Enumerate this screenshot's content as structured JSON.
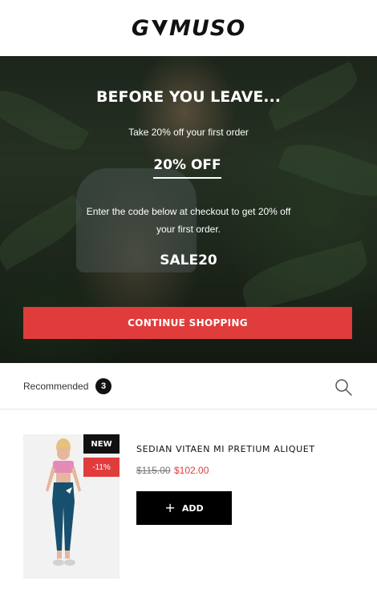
{
  "header": {
    "logo_left": "G",
    "logo_right": "MUSO",
    "logo_icon": "v-mark-icon"
  },
  "hero": {
    "title": "BEFORE YOU LEAVE...",
    "subtitle": "Take 20% off your first order",
    "discount_label": "20% OFF",
    "description": "Enter the code below at checkout to get 20% off your first order.",
    "code": "SALE20",
    "continue_label": "CONTINUE SHOPPING",
    "accent": "#e03c3c"
  },
  "recommended": {
    "label": "Recommended",
    "count": "3",
    "search_icon": "search-icon"
  },
  "product": {
    "badge_new": "NEW",
    "badge_discount": "-11%",
    "name": "SEDIAN VITAEN MI PRETIUM ALIQUET",
    "price_old": "$115.00",
    "price_new": "$102.00",
    "add_label": "ADD",
    "add_icon": "plus-icon"
  }
}
